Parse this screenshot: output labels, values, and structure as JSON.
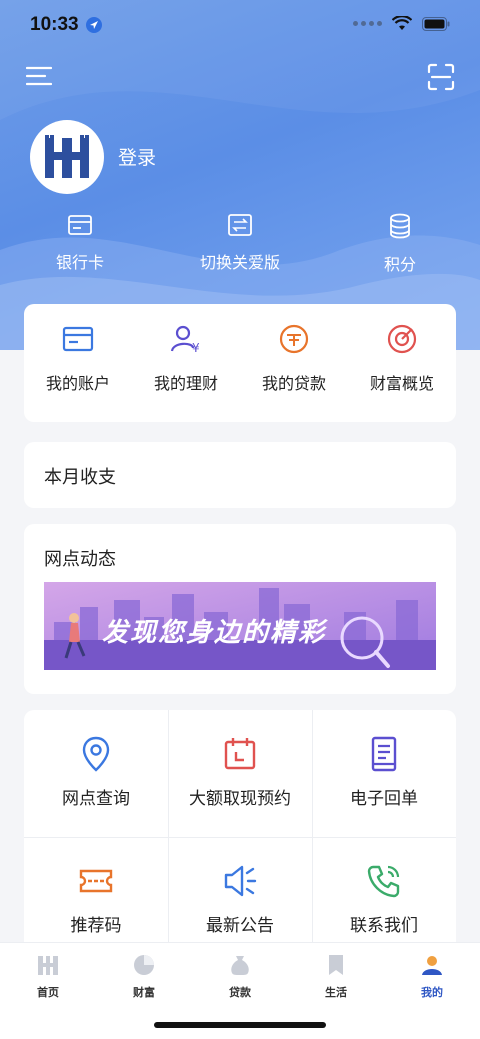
{
  "status": {
    "time": "10:33"
  },
  "header": {
    "login_label": "登录"
  },
  "quick": [
    {
      "label": "银行卡",
      "icon": "bank-card-icon"
    },
    {
      "label": "切换关爱版",
      "icon": "switch-icon"
    },
    {
      "label": "积分",
      "icon": "coins-icon"
    }
  ],
  "accounts": [
    {
      "label": "我的账户",
      "icon": "account-card-icon"
    },
    {
      "label": "我的理财",
      "icon": "finance-person-icon"
    },
    {
      "label": "我的贷款",
      "icon": "loan-icon"
    },
    {
      "label": "财富概览",
      "icon": "wealth-target-icon"
    }
  ],
  "monthly": {
    "title": "本月收支"
  },
  "branch_news": {
    "title": "网点动态",
    "banner_text": "发现您身边的精彩"
  },
  "services": [
    {
      "label": "网点查询",
      "icon": "location-pin-icon"
    },
    {
      "label": "大额取现预约",
      "icon": "calendar-icon"
    },
    {
      "label": "电子回单",
      "icon": "receipt-icon"
    },
    {
      "label": "推荐码",
      "icon": "ticket-icon"
    },
    {
      "label": "最新公告",
      "icon": "speaker-icon"
    },
    {
      "label": "联系我们",
      "icon": "phone-icon"
    }
  ],
  "tabs": [
    {
      "label": "首页",
      "icon": "home-icon"
    },
    {
      "label": "财富",
      "icon": "wealth-icon"
    },
    {
      "label": "贷款",
      "icon": "money-bag-icon"
    },
    {
      "label": "生活",
      "icon": "bookmark-icon"
    },
    {
      "label": "我的",
      "icon": "profile-icon"
    }
  ],
  "colors": {
    "accent_blue": "#5b8ee6",
    "tab_active": "#2f57c4",
    "icon_blue": "#3b78e0",
    "icon_red": "#e0524f",
    "icon_orange": "#e8742b",
    "icon_purple": "#5b4fd0",
    "icon_green": "#3bab6a"
  }
}
